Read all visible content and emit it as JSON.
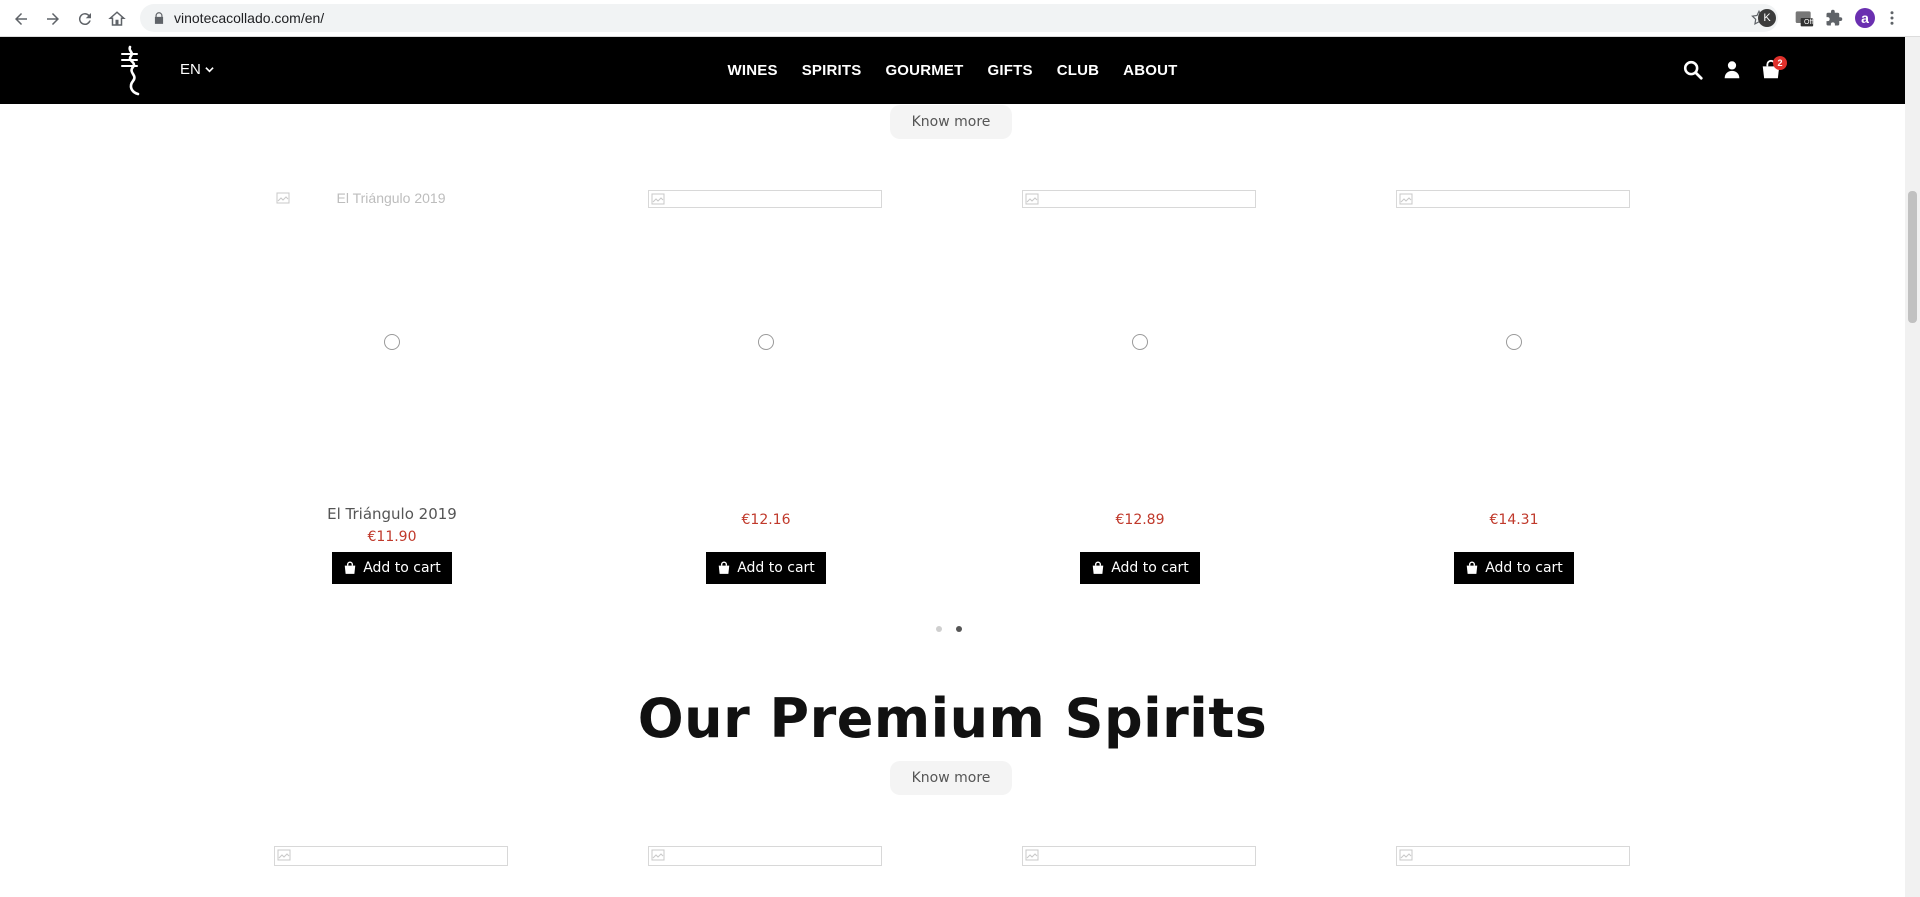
{
  "browser": {
    "url": "vinotecacollado.com/en/",
    "extension_k_label": "K",
    "extension_off_label": "Off",
    "profile_initial": "a"
  },
  "header": {
    "language": "EN",
    "nav": [
      "WINES",
      "SPIRITS",
      "GOURMET",
      "GIFTS",
      "CLUB",
      "ABOUT"
    ],
    "cart_count": "2"
  },
  "section_wines": {
    "know_more": "Know more",
    "products": [
      {
        "image_alt": "El Triángulo 2019",
        "name": "El Triángulo 2019",
        "price": "€11.90",
        "add_to_cart": "Add to cart"
      },
      {
        "image_alt": "",
        "name": "",
        "price": "€12.16",
        "add_to_cart": "Add to cart"
      },
      {
        "image_alt": "",
        "name": "",
        "price": "€12.89",
        "add_to_cart": "Add to cart"
      },
      {
        "image_alt": "",
        "name": "",
        "price": "€14.31",
        "add_to_cart": "Add to cart"
      }
    ],
    "carousel": {
      "pages": 2,
      "active_page": 2
    }
  },
  "section_spirits": {
    "title": "Our Premium Spirits",
    "know_more": "Know more"
  },
  "colors": {
    "header_bg": "#000000",
    "price": "#c0392b",
    "badge": "#e0302b"
  }
}
